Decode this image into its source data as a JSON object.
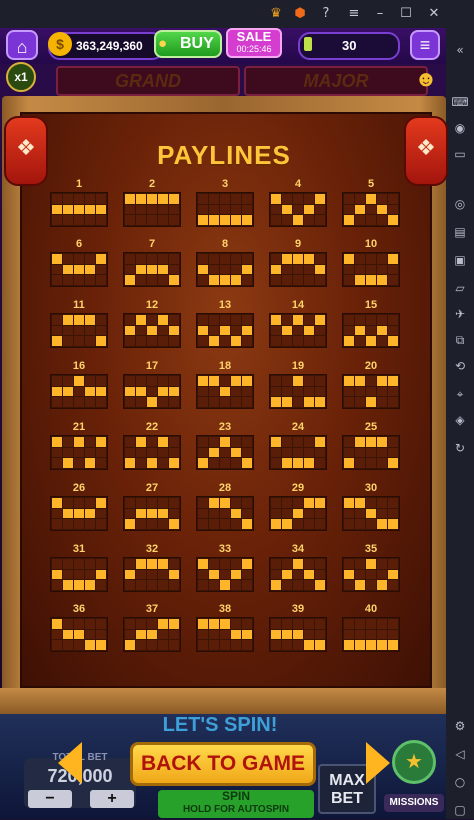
{
  "emulator": {
    "toolbar_icons": [
      "crown-icon",
      "app-icon",
      "help-icon",
      "menu-icon",
      "minimize-icon",
      "maximize-icon",
      "close-icon"
    ],
    "side_icons": [
      "keyboard-icon",
      "gamepad-icon",
      "screen-icon",
      "apk-icon",
      "folder-icon",
      "airplane-icon",
      "resize-icon",
      "rotate-icon",
      "location-icon",
      "layers-icon",
      "refresh-icon",
      "settings-icon",
      "back-icon",
      "home-icon"
    ]
  },
  "hud": {
    "coins": "363,249,360",
    "buy_label": "BUY",
    "sale_label": "SALE",
    "sale_timer": "00:25:46",
    "level": "30",
    "multiplier": "x1"
  },
  "jackpots": [
    "GRAND",
    "MAJOR"
  ],
  "paylines_title": "PAYLINES",
  "paylines": [
    {
      "n": "1",
      "grid": [
        "00000",
        "11111",
        "00000"
      ]
    },
    {
      "n": "2",
      "grid": [
        "11111",
        "00000",
        "00000"
      ]
    },
    {
      "n": "3",
      "grid": [
        "00000",
        "00000",
        "11111"
      ]
    },
    {
      "n": "4",
      "grid": [
        "10001",
        "01010",
        "00100"
      ]
    },
    {
      "n": "5",
      "grid": [
        "00100",
        "01010",
        "10001"
      ]
    },
    {
      "n": "6",
      "grid": [
        "10001",
        "01110",
        "00000"
      ]
    },
    {
      "n": "7",
      "grid": [
        "00000",
        "01110",
        "10001"
      ]
    },
    {
      "n": "8",
      "grid": [
        "00000",
        "10001",
        "01110"
      ]
    },
    {
      "n": "9",
      "grid": [
        "01110",
        "10001",
        "00000"
      ]
    },
    {
      "n": "10",
      "grid": [
        "10001",
        "00000",
        "01110"
      ]
    },
    {
      "n": "11",
      "grid": [
        "01110",
        "00000",
        "10001"
      ]
    },
    {
      "n": "12",
      "grid": [
        "01010",
        "10101",
        "00000"
      ]
    },
    {
      "n": "13",
      "grid": [
        "00000",
        "10101",
        "01010"
      ]
    },
    {
      "n": "14",
      "grid": [
        "10101",
        "01010",
        "00000"
      ]
    },
    {
      "n": "15",
      "grid": [
        "00000",
        "01010",
        "10101"
      ]
    },
    {
      "n": "16",
      "grid": [
        "00100",
        "11011",
        "00000"
      ]
    },
    {
      "n": "17",
      "grid": [
        "00000",
        "11011",
        "00100"
      ]
    },
    {
      "n": "18",
      "grid": [
        "11011",
        "00100",
        "00000"
      ]
    },
    {
      "n": "19",
      "grid": [
        "00100",
        "00000",
        "11011"
      ]
    },
    {
      "n": "20",
      "grid": [
        "11011",
        "00000",
        "00100"
      ]
    },
    {
      "n": "21",
      "grid": [
        "10101",
        "00000",
        "01010"
      ]
    },
    {
      "n": "22",
      "grid": [
        "01010",
        "00000",
        "10101"
      ]
    },
    {
      "n": "23",
      "grid": [
        "00100",
        "01010",
        "10001"
      ]
    },
    {
      "n": "24",
      "grid": [
        "10001",
        "00000",
        "01110"
      ]
    },
    {
      "n": "25",
      "grid": [
        "01110",
        "00000",
        "10001"
      ]
    },
    {
      "n": "26",
      "grid": [
        "10001",
        "01110",
        "00000"
      ]
    },
    {
      "n": "27",
      "grid": [
        "00000",
        "01110",
        "10001"
      ]
    },
    {
      "n": "28",
      "grid": [
        "01100",
        "00010",
        "00001"
      ]
    },
    {
      "n": "29",
      "grid": [
        "00011",
        "00100",
        "11000"
      ]
    },
    {
      "n": "30",
      "grid": [
        "11000",
        "00100",
        "00011"
      ]
    },
    {
      "n": "31",
      "grid": [
        "00000",
        "10001",
        "01110"
      ]
    },
    {
      "n": "32",
      "grid": [
        "01110",
        "10001",
        "00000"
      ]
    },
    {
      "n": "33",
      "grid": [
        "10001",
        "01010",
        "00100"
      ]
    },
    {
      "n": "34",
      "grid": [
        "00100",
        "01010",
        "10001"
      ]
    },
    {
      "n": "35",
      "grid": [
        "00100",
        "10001",
        "01010"
      ]
    },
    {
      "n": "36",
      "grid": [
        "10000",
        "01100",
        "00011"
      ]
    },
    {
      "n": "37",
      "grid": [
        "00011",
        "01100",
        "10000"
      ]
    },
    {
      "n": "38",
      "grid": [
        "11100",
        "00011",
        "00000"
      ]
    },
    {
      "n": "39",
      "grid": [
        "00000",
        "11100",
        "00011"
      ]
    },
    {
      "n": "40",
      "grid": [
        "00000",
        "00000",
        "11111"
      ]
    }
  ],
  "bottom": {
    "lets_spin": "LET'S SPIN!",
    "bet_label": "TOTAL BET",
    "bet_value": "720,000",
    "minus": "−",
    "plus": "+",
    "spin_label": "SPIN",
    "hold_label": "HOLD FOR AUTOSPIN",
    "max_bet_line1": "MAX",
    "max_bet_line2": "BET",
    "missions_label": "MISSIONS",
    "back_label": "BACK TO GAME"
  }
}
